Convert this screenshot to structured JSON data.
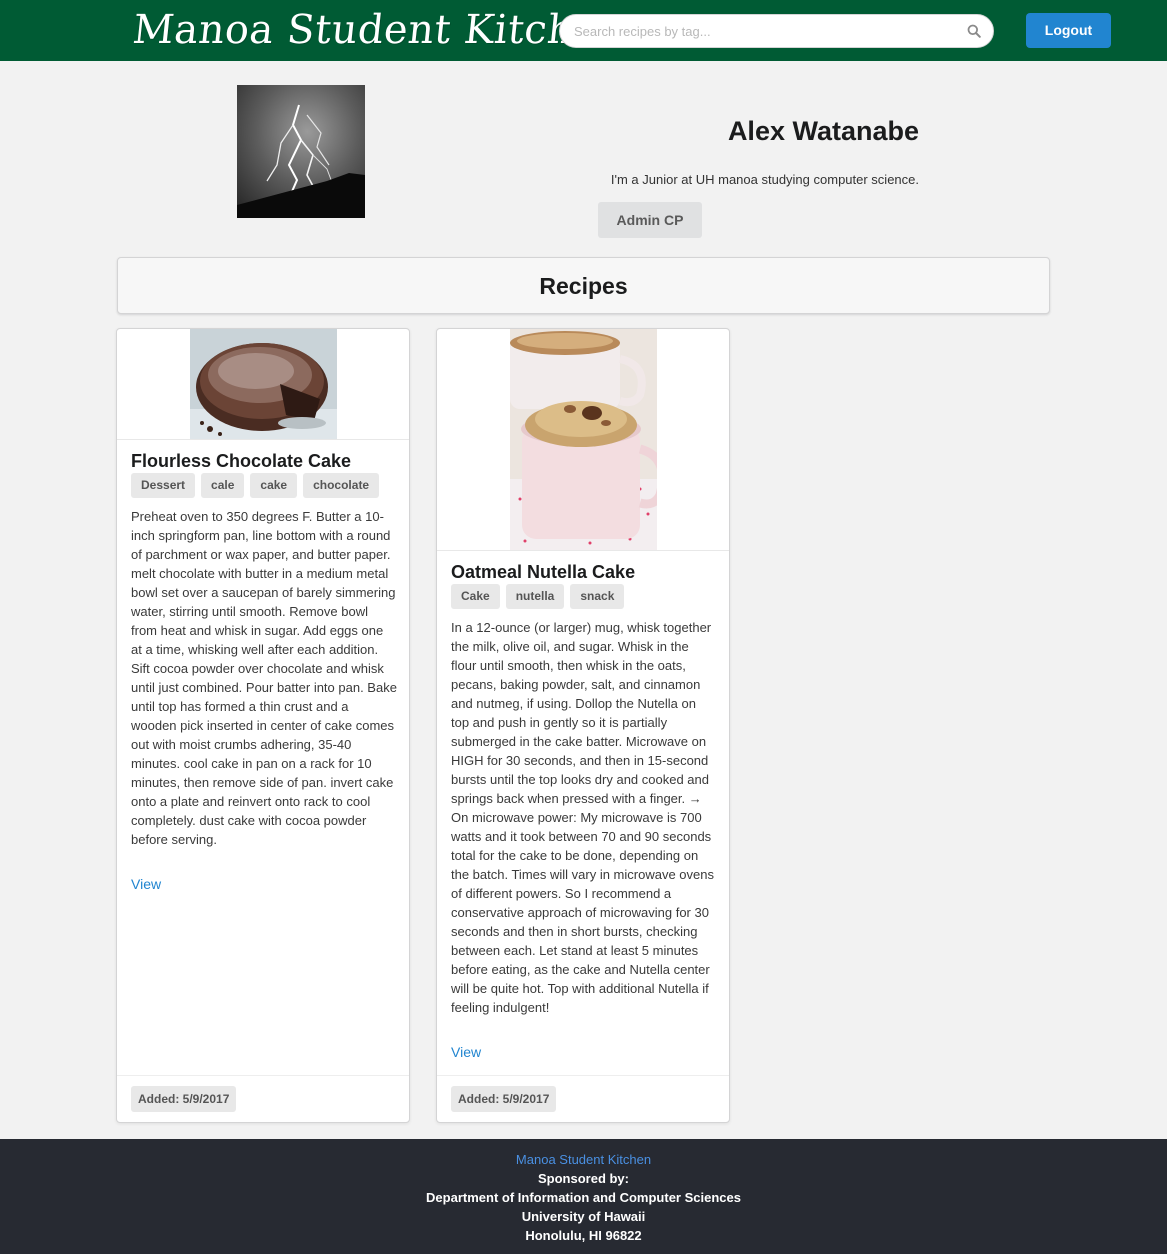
{
  "header": {
    "brand": "Manoa Student Kitchen",
    "search_placeholder": "Search recipes by tag...",
    "search_icon": "search-icon",
    "logout_label": "Logout"
  },
  "profile": {
    "name": "Alex Watanabe",
    "bio": "I'm a Junior at UH manoa studying computer science.",
    "admin_label": "Admin CP"
  },
  "recipes": {
    "heading": "Recipes",
    "items": [
      {
        "title": "Flourless Chocolate Cake",
        "tags": [
          "Dessert",
          "cale",
          "cake",
          "chocolate"
        ],
        "description": "Preheat oven to 350 degrees F. Butter a 10-inch springform pan, line bottom with a round of parchment or wax paper, and butter paper. melt chocolate with butter in a medium metal bowl set over a saucepan of barely simmering water, stirring until smooth. Remove bowl from heat and whisk in sugar. Add eggs one at a time, whisking well after each addition. Sift cocoa powder over chocolate and whisk until just combined. Pour batter into pan. Bake until top has formed a thin crust and a wooden pick inserted in center of cake comes out with moist crumbs adhering, 35-40 minutes. cool cake in pan on a rack for 10 minutes, then remove side of pan. invert cake onto a plate and reinvert onto rack to cool completely. dust cake with cocoa powder before serving.",
        "view_label": "View",
        "added": "Added: 5/9/2017"
      },
      {
        "title": "Oatmeal Nutella Cake",
        "tags": [
          "Cake",
          "nutella",
          "snack"
        ],
        "description": "In a 12-ounce (or larger) mug, whisk together the milk, olive oil, and sugar. Whisk in the flour until smooth, then whisk in the oats, pecans, baking powder, salt, and cinnamon and nutmeg, if using. Dollop the Nutella on top and push in gently so it is partially submerged in the cake batter. Microwave on HIGH for 30 seconds, and then in 15-second bursts until the top looks dry and cooked and springs back when pressed with a finger. → On microwave power: My microwave is 700 watts and it took between 70 and 90 seconds total for the cake to be done, depending on the batch. Times will vary in microwave ovens of different powers. So I recommend a conservative approach of microwaving for 30 seconds and then in short bursts, checking between each. Let stand at least 5 minutes before eating, as the cake and Nutella center will be quite hot. Top with additional Nutella if feeling indulgent!",
        "view_label": "View",
        "added": "Added: 5/9/2017"
      }
    ]
  },
  "footer": {
    "link": "Manoa Student Kitchen",
    "sponsored": "Sponsored by:",
    "department": "Department of Information and Computer Sciences",
    "university": "University of Hawaii",
    "address": "Honolulu, HI 96822"
  },
  "colors": {
    "header_bg": "#005b34",
    "primary_button": "#2185d0",
    "footer_bg": "#272a32",
    "footer_link": "#4a90e2"
  }
}
